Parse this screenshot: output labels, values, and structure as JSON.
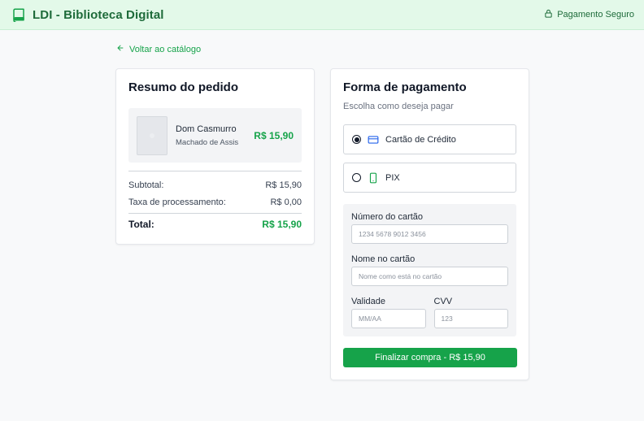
{
  "header": {
    "brand_icon": "book-icon",
    "title": "LDI - Biblioteca Digital",
    "secure_icon": "lock-icon",
    "secure_label": "Pagamento Seguro"
  },
  "nav": {
    "back_icon": "arrow-left-icon",
    "back_label": "Voltar ao catálogo"
  },
  "summary": {
    "title": "Resumo do pedido",
    "item": {
      "title": "Dom Casmurro",
      "author": "Machado de Assis",
      "price": "R$ 15,90"
    },
    "subtotal_label": "Subtotal:",
    "subtotal_value": "R$ 15,90",
    "fee_label": "Taxa de processamento:",
    "fee_value": "R$ 0,00",
    "total_label": "Total:",
    "total_value": "R$ 15,90"
  },
  "payment": {
    "title": "Forma de pagamento",
    "subtitle": "Escolha como deseja pagar",
    "methods": [
      {
        "label": "Cartão de Crédito",
        "icon": "credit-card-icon",
        "selected": true
      },
      {
        "label": "PIX",
        "icon": "smartphone-icon",
        "selected": false
      }
    ],
    "card_number_label": "Número do cartão",
    "card_number_placeholder": "1234 5678 9012 3456",
    "card_name_label": "Nome no cartão",
    "card_name_placeholder": "Nome como está no cartão",
    "expiry_label": "Validade",
    "expiry_placeholder": "MM/AA",
    "cvv_label": "CVV",
    "cvv_placeholder": "123",
    "submit_label": "Finalizar compra - R$ 15,90"
  },
  "colors": {
    "accent": "#16a34a",
    "brand_dark": "#1e6b3a",
    "header_bg": "#e3f9e9",
    "card_icon": "#2563eb"
  }
}
